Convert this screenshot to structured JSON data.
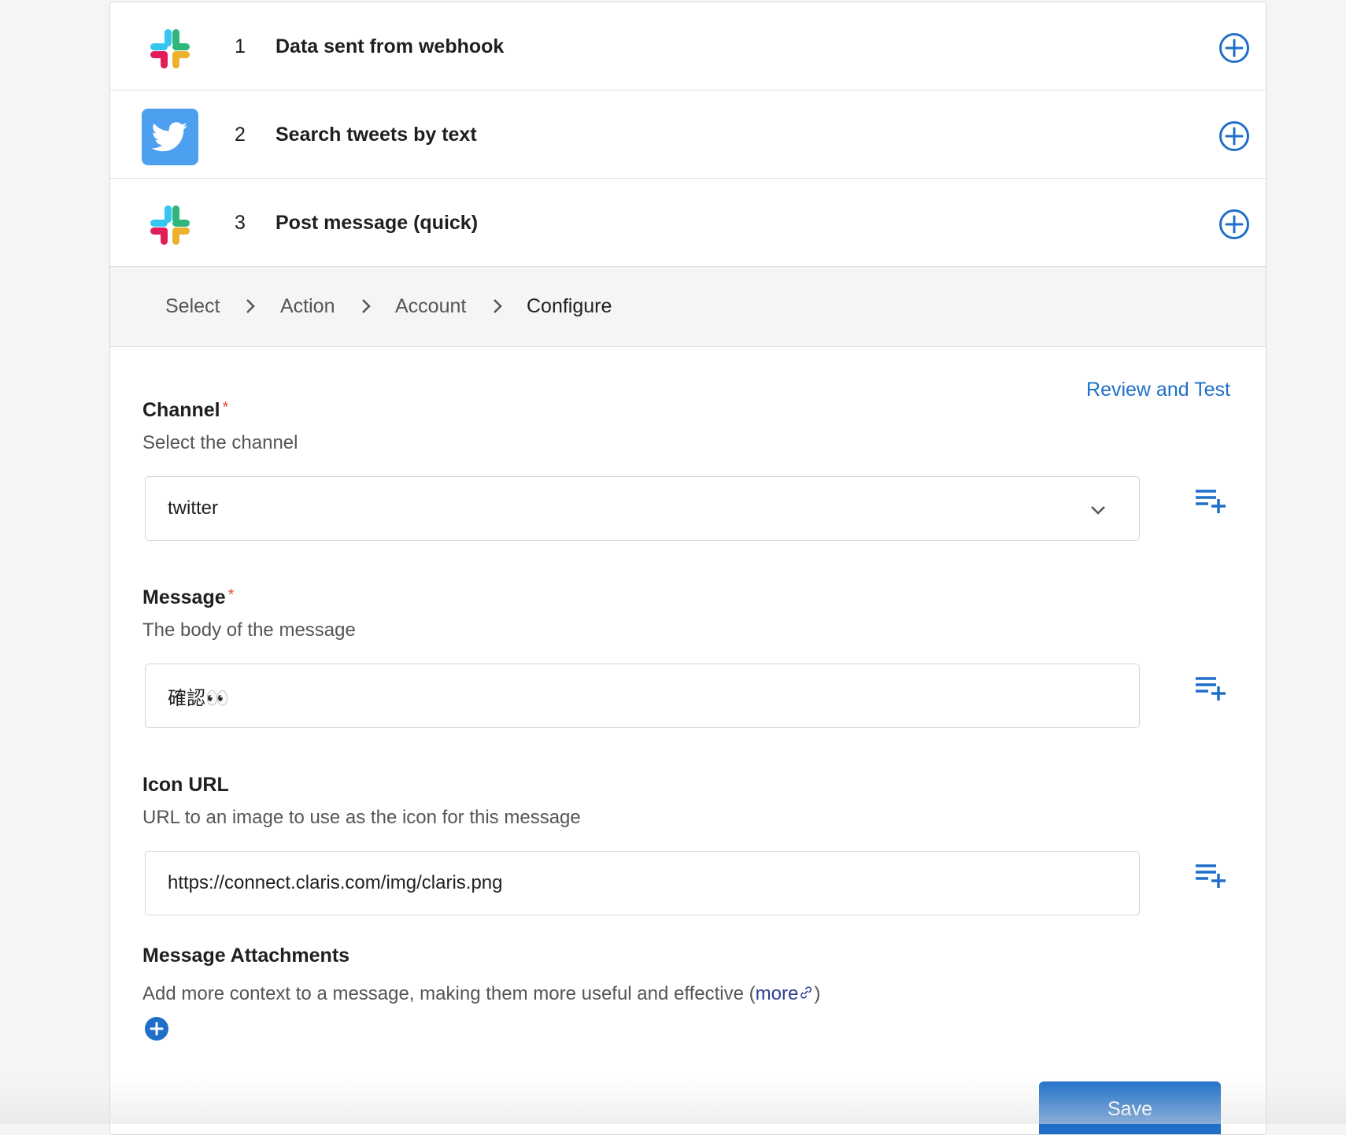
{
  "steps": [
    {
      "number": "1",
      "title": "Data sent from webhook",
      "app": "slack"
    },
    {
      "number": "2",
      "title": "Search tweets by text",
      "app": "twitter"
    },
    {
      "number": "3",
      "title": "Post message (quick)",
      "app": "slack"
    }
  ],
  "breadcrumb": [
    "Select",
    "Action",
    "Account",
    "Configure"
  ],
  "review_link": "Review and Test",
  "fields": {
    "channel": {
      "label": "Channel",
      "required_mark": "*",
      "help": "Select the channel",
      "value": "twitter"
    },
    "message": {
      "label": "Message",
      "required_mark": "*",
      "help": "The body of the message",
      "value": "確認👀"
    },
    "icon_url": {
      "label": "Icon URL",
      "help": "URL to an image to use as the icon for this message",
      "value": "https://connect.claris.com/img/claris.png"
    },
    "attachments": {
      "label": "Message Attachments",
      "help_prefix": "Add more context to a message, making them more useful and effective (",
      "more_label": "more",
      "help_suffix": ")"
    }
  },
  "save_label": "Save",
  "colors": {
    "accent": "#1f6fc9",
    "twitter": "#4d9ff0",
    "required": "#e0533e"
  },
  "icons": {
    "add_step": "plus-circle-icon",
    "insert_data": "playlist-add-icon",
    "link": "link-icon",
    "dropdown": "chevron-down-icon",
    "breadcrumb_sep": "chevron-right-icon"
  }
}
